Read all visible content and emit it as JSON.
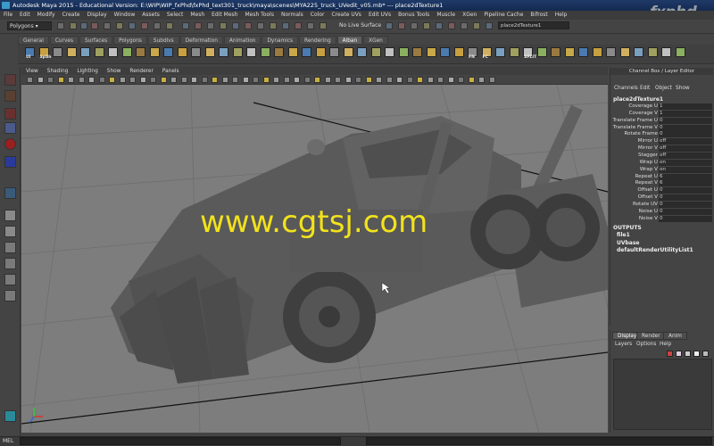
{
  "window": {
    "title": "Autodesk Maya 2015 - Educational Version: E:\\WIP\\WIP_fxPhd\\fxPhd_text301_truck\\maya\\scenes\\MYA225_truck_UVedit_v05.mb*  ---  place2dTexture1"
  },
  "watermark_logo": "fxphd",
  "menubar": [
    "File",
    "Edit",
    "Modify",
    "Create",
    "Display",
    "Window",
    "Assets",
    "Select",
    "Mesh",
    "Edit Mesh",
    "Mesh Tools",
    "Normals",
    "Color",
    "Create UVs",
    "Edit UVs",
    "Bonus Tools",
    "Muscle",
    "XGen",
    "Pipeline Cache",
    "Bifrost",
    "Help"
  ],
  "status_line": {
    "mode": "Polygons",
    "live_surface": "No Live Surface",
    "selection_field": "place2dTexture1"
  },
  "shelf_tabs": [
    "General",
    "Curves",
    "Surfaces",
    "Polygons",
    "Subdivs",
    "Deformation",
    "Animation",
    "Dynamics",
    "Rendering",
    "Alban",
    "XGen"
  ],
  "shelf_active": "Alban",
  "shelf_labels": [
    "UI",
    "SpSh",
    "FN",
    "FC",
    "SPLIT"
  ],
  "panel_menu": [
    "View",
    "Shading",
    "Lighting",
    "Show",
    "Renderer",
    "Panels"
  ],
  "overlay_text": "www.cgtsj.com",
  "channel_box": {
    "header": "Channel Box / Layer Editor",
    "menu": [
      "Channels",
      "Edit",
      "Object",
      "Show"
    ],
    "node": "place2dTexture1",
    "attributes": [
      {
        "label": "Coverage U",
        "value": "1"
      },
      {
        "label": "Coverage V",
        "value": "1"
      },
      {
        "label": "Translate Frame U",
        "value": "0"
      },
      {
        "label": "Translate Frame V",
        "value": "0"
      },
      {
        "label": "Rotate Frame",
        "value": "0"
      },
      {
        "label": "Mirror U",
        "value": "off"
      },
      {
        "label": "Mirror V",
        "value": "off"
      },
      {
        "label": "Stagger",
        "value": "off"
      },
      {
        "label": "Wrap U",
        "value": "on"
      },
      {
        "label": "Wrap V",
        "value": "on"
      },
      {
        "label": "Repeat U",
        "value": "6"
      },
      {
        "label": "Repeat V",
        "value": "6"
      },
      {
        "label": "Offset U",
        "value": "0"
      },
      {
        "label": "Offset V",
        "value": "0"
      },
      {
        "label": "Rotate UV",
        "value": "0"
      },
      {
        "label": "Noise U",
        "value": "0"
      },
      {
        "label": "Noise V",
        "value": "0"
      }
    ],
    "outputs_label": "OUTPUTS",
    "outputs": [
      "file1",
      "UVbase",
      "defaultRenderUtilityList1"
    ]
  },
  "layer_editor": {
    "tabs": [
      "Display",
      "Render",
      "Anim"
    ],
    "active_tab": "Display",
    "menu": [
      "Layers",
      "Options",
      "Help"
    ]
  },
  "command_line": {
    "label": "MEL"
  },
  "colors": {
    "viewport_bg": "#7d7d7d",
    "overlay_text": "#f2e21c",
    "title_bg": "#1f3a68"
  }
}
